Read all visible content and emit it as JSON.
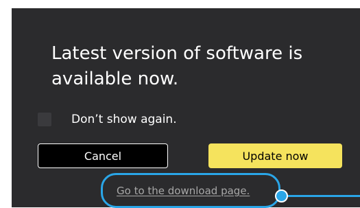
{
  "dialog": {
    "message": "Latest version of software is available now.",
    "checkbox": {
      "label": "Don’t show again.",
      "checked": false
    },
    "buttons": {
      "cancel_label": "Cancel",
      "update_label": "Update now"
    },
    "link_label": "Go to the download page."
  },
  "colors": {
    "dialog_background": "#2b2b2d",
    "primary_button": "#f5e35d",
    "highlight": "#2aa6e8",
    "link": "#a8a8a8"
  }
}
